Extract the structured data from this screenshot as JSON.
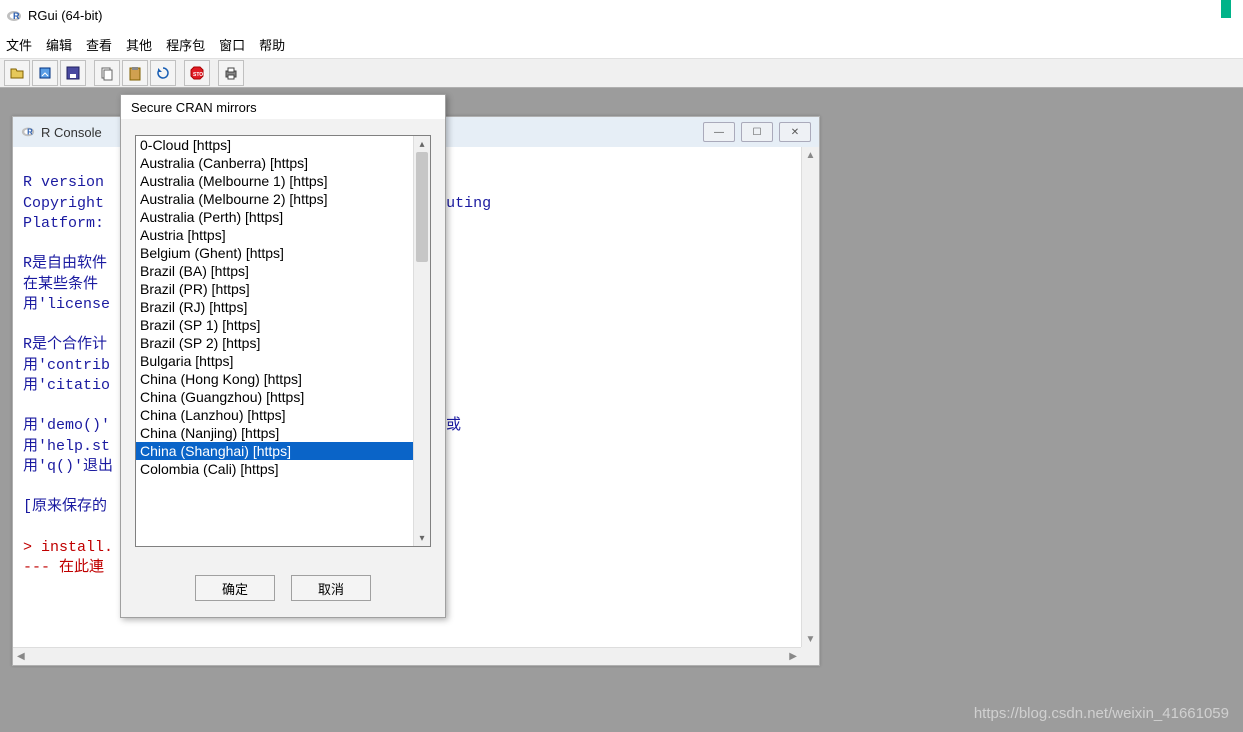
{
  "app": {
    "title": "RGui (64-bit)"
  },
  "menubar": [
    "文件",
    "编辑",
    "查看",
    "其他",
    "程序包",
    "窗口",
    "帮助"
  ],
  "toolbar_icons": [
    "open-icon",
    "load-ws-icon",
    "save-icon",
    "copy-icon",
    "paste-icon",
    "refresh-icon",
    "stop-icon",
    "print-icon"
  ],
  "console": {
    "title": "R Console",
    "lines": [
      {
        "cls": "",
        "t": ""
      },
      {
        "cls": "blue",
        "t": "R version                        pray\""
      },
      {
        "cls": "blue",
        "t": "Copyright                        atistical Computing"
      },
      {
        "cls": "blue",
        "t": "Platform: "
      },
      {
        "cls": "",
        "t": ""
      },
      {
        "cls": "blue",
        "t": "R是自由软件"
      },
      {
        "cls": "blue",
        "t": "在某些条件"
      },
      {
        "cls": "blue",
        "t": "用'license                        件。"
      },
      {
        "cls": "",
        "t": ""
      },
      {
        "cls": "blue",
        "t": "R是个合作计"
      },
      {
        "cls": "blue",
        "t": "用'contrib"
      },
      {
        "cls": "blue",
        "t": "用'citatio                        引用R或R程序包。"
      },
      {
        "cls": "",
        "t": ""
      },
      {
        "cls": "blue",
        "t": "用'demo()'                        读在线帮助文件，或"
      },
      {
        "cls": "blue",
        "t": "用'help.st"
      },
      {
        "cls": "blue",
        "t": "用'q()'退出"
      },
      {
        "cls": "",
        "t": ""
      },
      {
        "cls": "blue",
        "t": "[原来保存的"
      },
      {
        "cls": "",
        "t": ""
      },
      {
        "cls": "red",
        "t": "> install."
      },
      {
        "cls": "red",
        "t": "--- 在此連"
      }
    ]
  },
  "dialog": {
    "title": "Secure CRAN mirrors",
    "selected_index": 18,
    "ok": "确定",
    "cancel": "取消",
    "items": [
      "0-Cloud [https]",
      "Australia (Canberra) [https]",
      "Australia (Melbourne 1) [https]",
      "Australia (Melbourne 2) [https]",
      "Australia (Perth) [https]",
      "Austria [https]",
      "Belgium (Ghent) [https]",
      "Brazil (BA) [https]",
      "Brazil (PR) [https]",
      "Brazil (RJ) [https]",
      "Brazil (SP 1) [https]",
      "Brazil (SP 2) [https]",
      "Bulgaria [https]",
      "China (Hong Kong) [https]",
      "China (Guangzhou) [https]",
      "China (Lanzhou) [https]",
      "China (Nanjing) [https]",
      "China (Shanghai) [https]",
      "Colombia (Cali) [https]"
    ]
  },
  "watermark": "https://blog.csdn.net/weixin_41661059"
}
